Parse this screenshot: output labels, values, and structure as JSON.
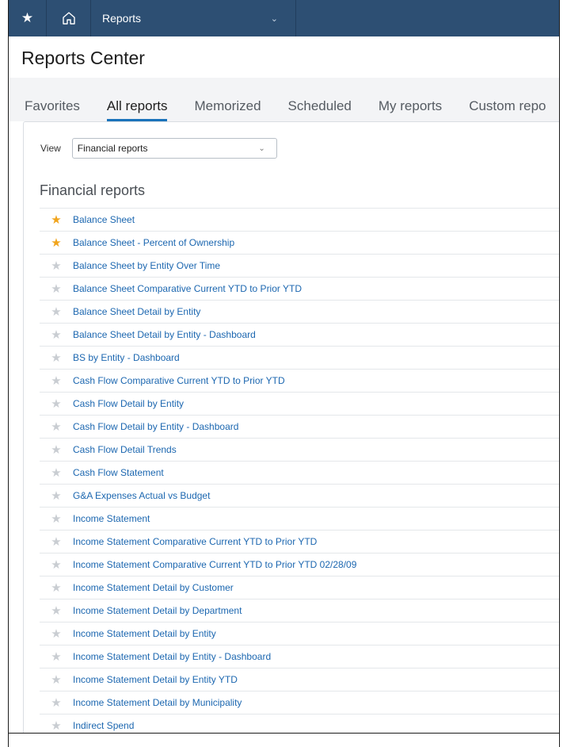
{
  "nav": {
    "star_icon": "★",
    "home_icon": "⌂",
    "menu_label": "Reports",
    "menu_chevron": "⌄"
  },
  "header": {
    "title": "Reports Center"
  },
  "tabs": [
    {
      "label": "Favorites",
      "active": false
    },
    {
      "label": "All reports",
      "active": true
    },
    {
      "label": "Memorized",
      "active": false
    },
    {
      "label": "Scheduled",
      "active": false
    },
    {
      "label": "My reports",
      "active": false
    },
    {
      "label": "Custom repo",
      "active": false
    }
  ],
  "view": {
    "label": "View",
    "selected": "Financial reports",
    "chevron": "⌄"
  },
  "section": {
    "title": "Financial reports"
  },
  "reports": [
    {
      "name": "Balance Sheet",
      "favorite": true
    },
    {
      "name": "Balance Sheet - Percent of Ownership",
      "favorite": true
    },
    {
      "name": "Balance Sheet by Entity Over Time",
      "favorite": false
    },
    {
      "name": "Balance Sheet Comparative Current YTD to Prior YTD",
      "favorite": false
    },
    {
      "name": "Balance Sheet Detail by Entity",
      "favorite": false
    },
    {
      "name": "Balance Sheet Detail by Entity - Dashboard",
      "favorite": false
    },
    {
      "name": "BS by Entity - Dashboard",
      "favorite": false
    },
    {
      "name": "Cash Flow Comparative Current YTD to Prior YTD",
      "favorite": false
    },
    {
      "name": "Cash Flow Detail by Entity",
      "favorite": false
    },
    {
      "name": "Cash Flow Detail by Entity - Dashboard",
      "favorite": false
    },
    {
      "name": "Cash Flow Detail Trends",
      "favorite": false
    },
    {
      "name": "Cash Flow Statement",
      "favorite": false
    },
    {
      "name": "G&A Expenses Actual vs Budget",
      "favorite": false
    },
    {
      "name": "Income Statement",
      "favorite": false
    },
    {
      "name": "Income Statement Comparative Current YTD to Prior YTD",
      "favorite": false
    },
    {
      "name": "Income Statement Comparative Current YTD to Prior YTD 02/28/09",
      "favorite": false
    },
    {
      "name": "Income Statement Detail by Customer",
      "favorite": false
    },
    {
      "name": "Income Statement Detail by Department",
      "favorite": false
    },
    {
      "name": "Income Statement Detail by Entity",
      "favorite": false
    },
    {
      "name": "Income Statement Detail by Entity - Dashboard",
      "favorite": false
    },
    {
      "name": "Income Statement Detail by Entity YTD",
      "favorite": false
    },
    {
      "name": "Income Statement Detail by Municipality",
      "favorite": false
    },
    {
      "name": "Indirect Spend",
      "favorite": false
    }
  ],
  "colors": {
    "nav_bg": "#2d4f73",
    "link": "#1c67b0",
    "favorite_star": "#f1a41c",
    "inactive_star": "#c9cdd2",
    "active_tab_underline": "#1a73bb"
  }
}
